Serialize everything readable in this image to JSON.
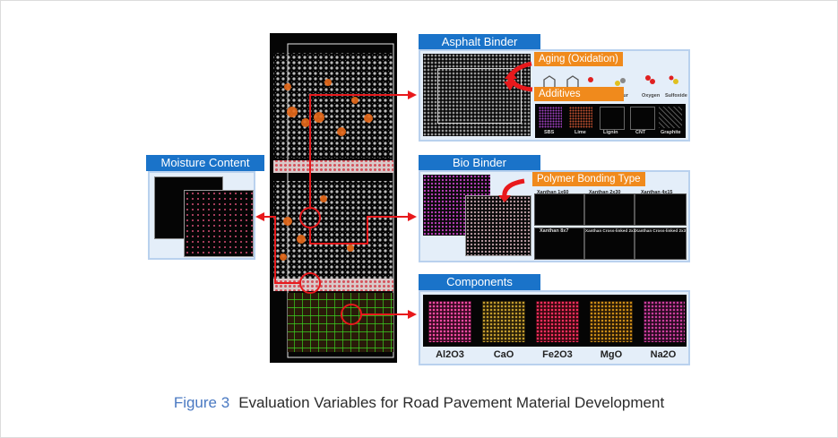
{
  "labels": {
    "moisture": "Moisture Content",
    "asphalt": "Asphalt Binder",
    "bio": "Bio Binder",
    "components": "Components",
    "aging": "Aging (Oxidation)",
    "additives": "Additives",
    "polymer": "Polymer Bonding Type"
  },
  "additives_items": [
    "SBS",
    "Lime",
    "Lignin",
    "CNT",
    "Graphite"
  ],
  "xanthan_items": [
    "Xanthan 1x60",
    "Xanthan 2x30",
    "Xanthan 4x15",
    "Xanthan 8x7",
    "Xanthan Cross-linked 2x3",
    "Xanthan Cross-linked 2x3"
  ],
  "aging_items": [
    "Sulfur",
    "Oxygen",
    "Sulfoxide"
  ],
  "component_items": [
    "Al2O3",
    "CaO",
    "Fe2O3",
    "MgO",
    "Na2O"
  ],
  "caption": {
    "figure": "Figure 3",
    "text": "Evaluation Variables for Road Pavement Material Development"
  },
  "colors": {
    "blue": "#1a73c9",
    "orange": "#f08a1c",
    "arrow": "#e8191c",
    "panel": "#e4eef9",
    "panel_border": "#b9d1ee"
  }
}
